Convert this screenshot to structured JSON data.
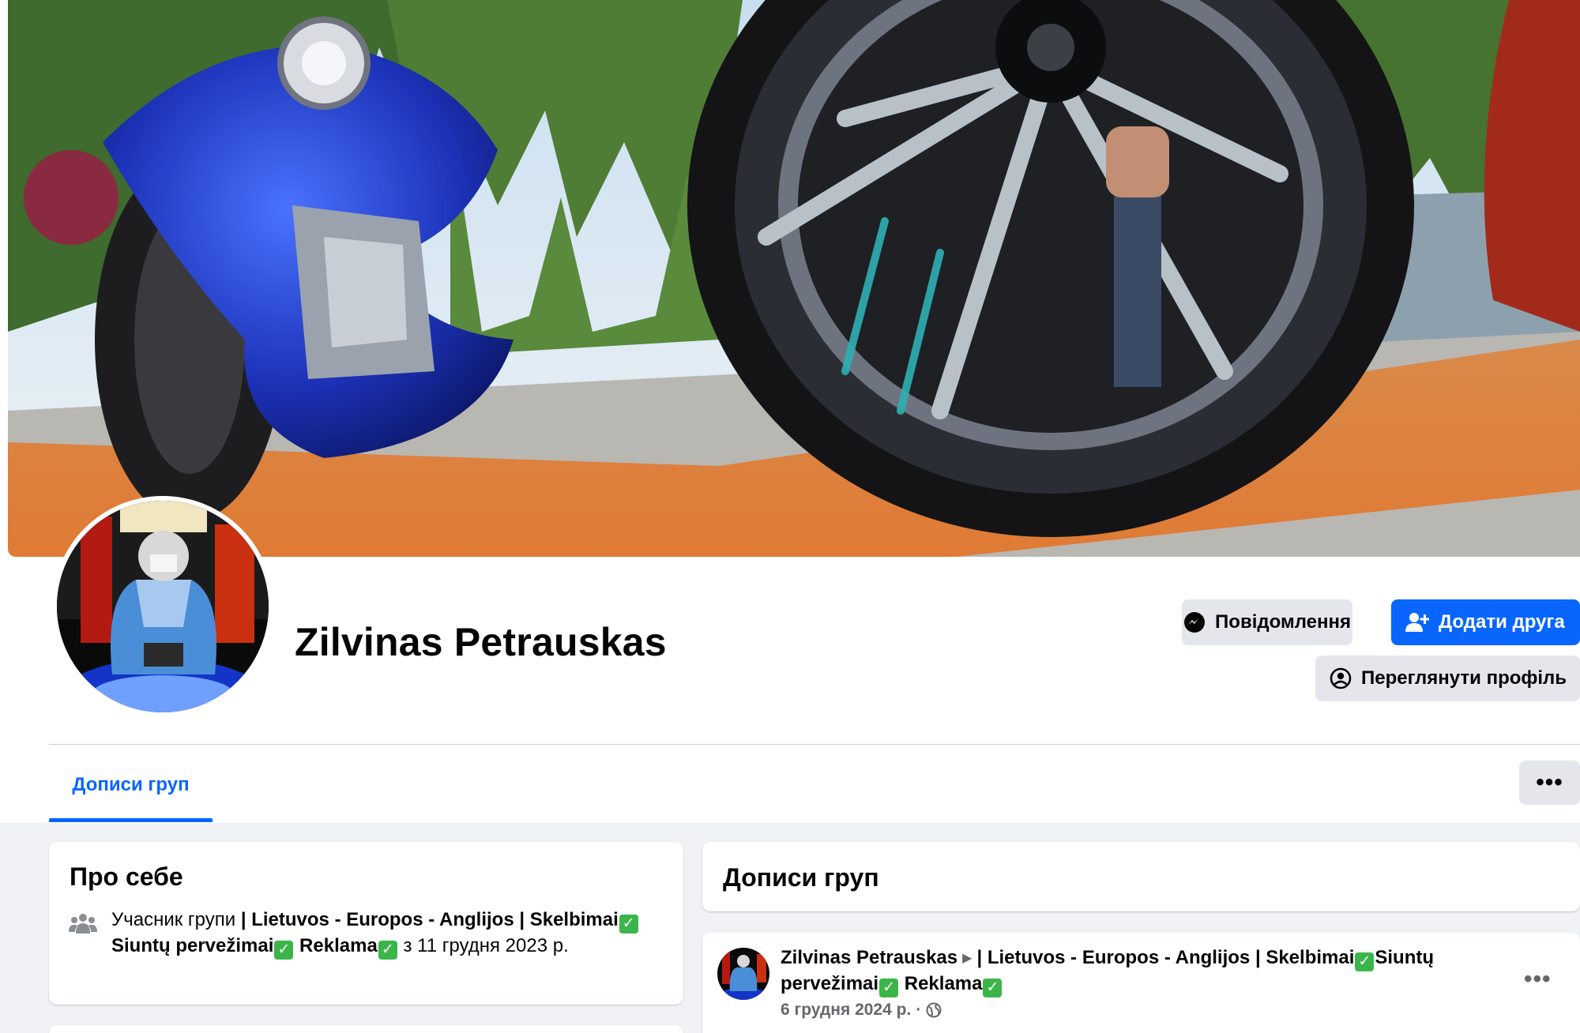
{
  "profile": {
    "name": "Zilvinas Petrauskas"
  },
  "actions": {
    "message_label": "Повідомлення",
    "add_friend_label": "Додати друга",
    "view_profile_label": "Переглянути профіль",
    "more_icon": "ellipsis-icon"
  },
  "tabs": [
    {
      "label": "Дописи груп",
      "active": true
    }
  ],
  "about": {
    "title": "Про себе",
    "icon": "group-icon",
    "text_prefix": "Учасник групи ",
    "group_part1": "| Lietuvos - Europos - Anglijos | Skelbimai",
    "group_part2": "Siuntų pervežimai",
    "group_part3": " Reklama",
    "text_suffix": " з 11 грудня 2023 р."
  },
  "group_posts": {
    "title": "Дописи груп",
    "post": {
      "author": "Zilvinas Petrauskas",
      "group_part1": "| Lietuvos - Europos - Anglijos | Skelbimai",
      "group_part2": "Siuntų pervežimai",
      "group_part3": " Reklama",
      "date": "6 грудня 2024 р.",
      "separator": "·",
      "audience_icon": "globe-icon"
    }
  },
  "colors": {
    "accent": "#0866ff",
    "secondary_button": "#e4e6eb",
    "background": "#f0f2f5",
    "check_emoji": "#3bb54a"
  }
}
